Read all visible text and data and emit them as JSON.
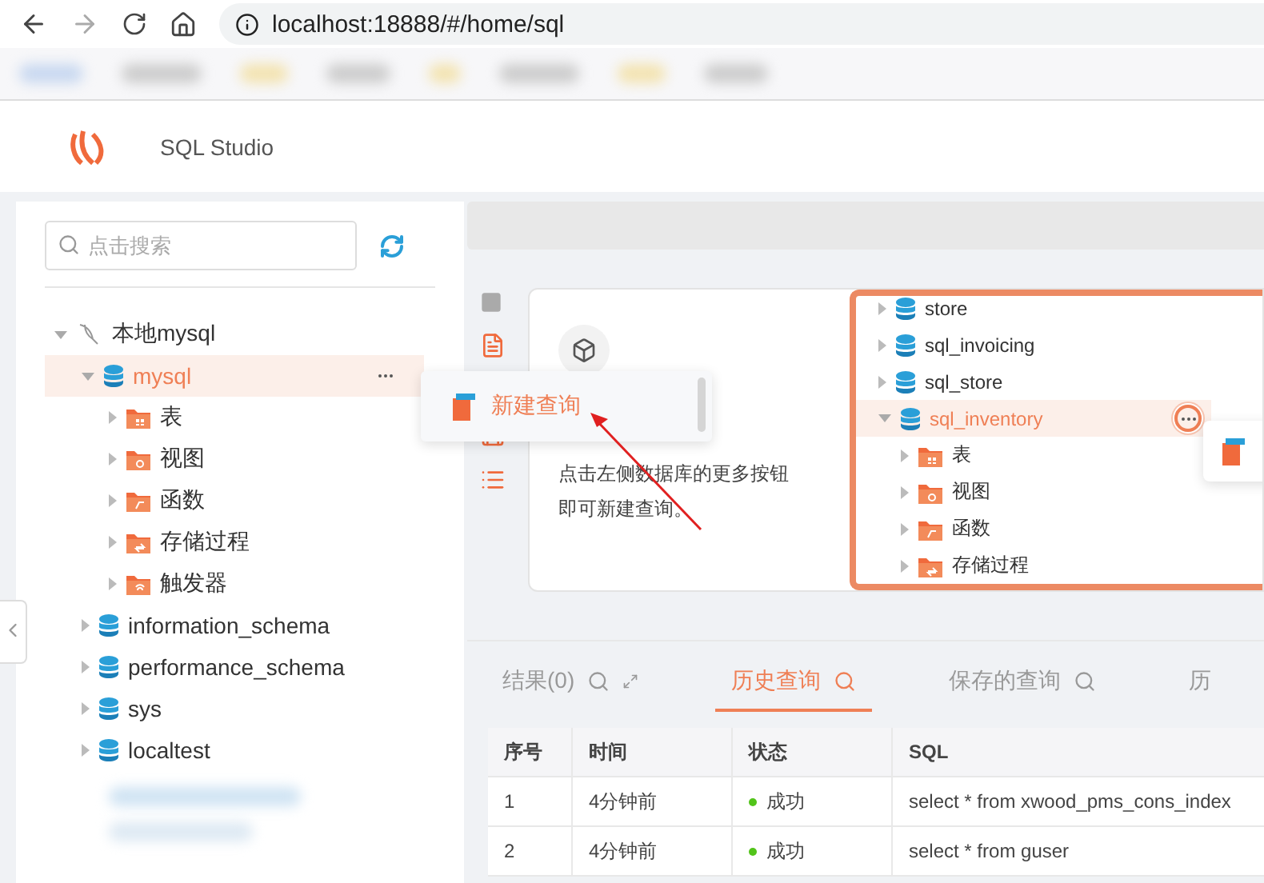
{
  "browser": {
    "url": "localhost:18888/#/home/sql"
  },
  "header": {
    "title": "SQL Studio"
  },
  "sidebar": {
    "search": {
      "placeholder": "点击搜索"
    },
    "tree": [
      {
        "label": "本地mysql",
        "kind": "connection",
        "expanded": true,
        "selected": false,
        "children": [
          {
            "label": "mysql",
            "kind": "database",
            "expanded": true,
            "selected": true,
            "children": [
              {
                "label": "表",
                "kind": "tables",
                "expanded": false,
                "selected": false
              },
              {
                "label": "视图",
                "kind": "views",
                "expanded": false,
                "selected": false
              },
              {
                "label": "函数",
                "kind": "functions",
                "expanded": false,
                "selected": false
              },
              {
                "label": "存储过程",
                "kind": "procedures",
                "expanded": false,
                "selected": false
              },
              {
                "label": "触发器",
                "kind": "triggers",
                "expanded": false,
                "selected": false
              }
            ]
          },
          {
            "label": "information_schema",
            "kind": "database",
            "expanded": false,
            "selected": false
          },
          {
            "label": "performance_schema",
            "kind": "database",
            "expanded": false,
            "selected": false
          },
          {
            "label": "sys",
            "kind": "database",
            "expanded": false,
            "selected": false
          },
          {
            "label": "localtest",
            "kind": "database",
            "expanded": false,
            "selected": false
          }
        ]
      }
    ]
  },
  "context_menu": {
    "items": [
      {
        "label": "新建查询"
      }
    ]
  },
  "help_card": {
    "lines": [
      "点击左侧数据库的更多按钮",
      "即可新建查询。"
    ],
    "example_tree": [
      {
        "label": "store",
        "kind": "database",
        "expanded": false,
        "selected": false
      },
      {
        "label": "sql_invoicing",
        "kind": "database",
        "expanded": false,
        "selected": false
      },
      {
        "label": "sql_store",
        "kind": "database",
        "expanded": false,
        "selected": false
      },
      {
        "label": "sql_inventory",
        "kind": "database",
        "expanded": true,
        "selected": true,
        "children": [
          {
            "label": "表",
            "kind": "tables",
            "expanded": false,
            "selected": false
          },
          {
            "label": "视图",
            "kind": "views",
            "expanded": false,
            "selected": false
          },
          {
            "label": "函数",
            "kind": "functions",
            "expanded": false,
            "selected": false
          },
          {
            "label": "存储过程",
            "kind": "procedures",
            "expanded": false,
            "selected": false
          }
        ]
      }
    ]
  },
  "result_tabs": [
    {
      "label": "结果(0)",
      "selected": false,
      "expandable": true
    },
    {
      "label": "历史查询",
      "selected": true,
      "expandable": false
    },
    {
      "label": "保存的查询",
      "selected": false,
      "expandable": false
    },
    {
      "label": "历",
      "selected": false,
      "expandable": false
    }
  ],
  "history_table": {
    "columns": [
      "序号",
      "时间",
      "状态",
      "SQL"
    ],
    "rows": [
      {
        "index": "1",
        "time": "4分钟前",
        "status": "成功",
        "color": "#52c41a",
        "sql": "select * from xwood_pms_cons_index"
      },
      {
        "index": "2",
        "time": "4分钟前",
        "status": "成功",
        "color": "#52c41a",
        "sql": "select * from guser"
      }
    ]
  }
}
